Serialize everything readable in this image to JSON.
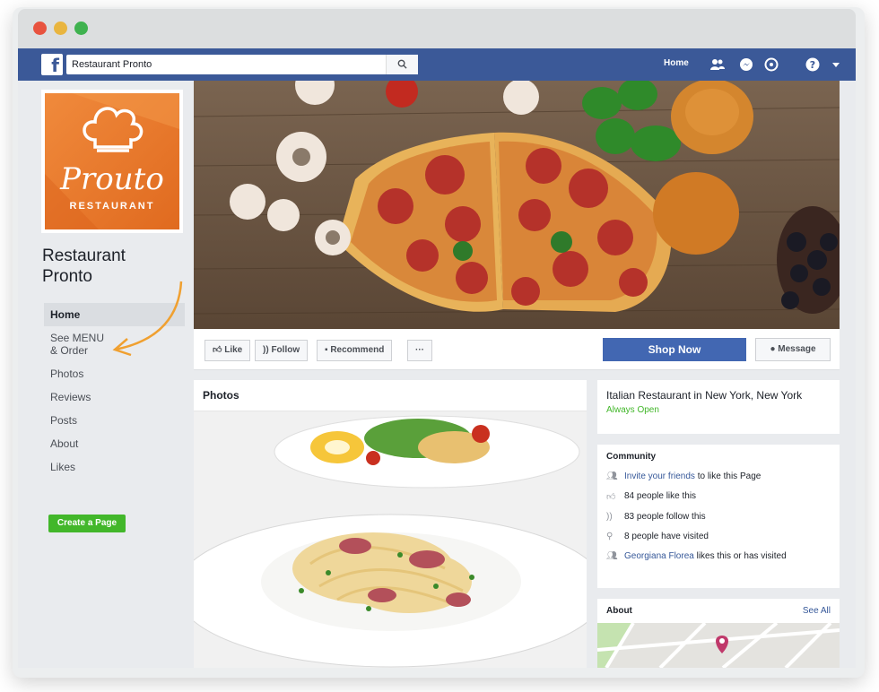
{
  "window": {
    "search_value": "Restaurant Pronto"
  },
  "nav": {
    "home": "Home",
    "icons": [
      "friends-icon",
      "messenger-icon",
      "notifications-icon",
      "help-icon",
      "dropdown-icon"
    ]
  },
  "profile": {
    "logo_script": "Prouto",
    "logo_sub": "RESTAURANT",
    "page_name": "Restaurant Pronto"
  },
  "sidebar": {
    "items": [
      {
        "label": "Home"
      },
      {
        "label": "See MENU & Order"
      },
      {
        "label": "Photos"
      },
      {
        "label": "Reviews"
      },
      {
        "label": "Posts"
      },
      {
        "label": "About"
      },
      {
        "label": "Likes"
      }
    ],
    "create_page": "Create a Page"
  },
  "actions": {
    "like": "Like",
    "follow": "Follow",
    "recommend": "Recommend",
    "more": "···",
    "shop_now": "Shop Now",
    "message": "Message"
  },
  "photos": {
    "title": "Photos"
  },
  "info": {
    "category": "Italian Restaurant in New York, New York",
    "hours": "Always Open"
  },
  "community": {
    "title": "Community",
    "invite_link": "Invite your friends",
    "invite_rest": " to like this Page",
    "likes": "84 people like this",
    "follows": "83 people follow this",
    "visited": "8 people have visited",
    "friend_link": "Georgiana Florea",
    "friend_rest": " likes this or has visited"
  },
  "about": {
    "title": "About",
    "see_all": "See All"
  },
  "colors": {
    "facebook_blue": "#3b5998",
    "button_blue": "#4267b2",
    "green": "#42b72a",
    "accent_orange": "#f0a030"
  }
}
